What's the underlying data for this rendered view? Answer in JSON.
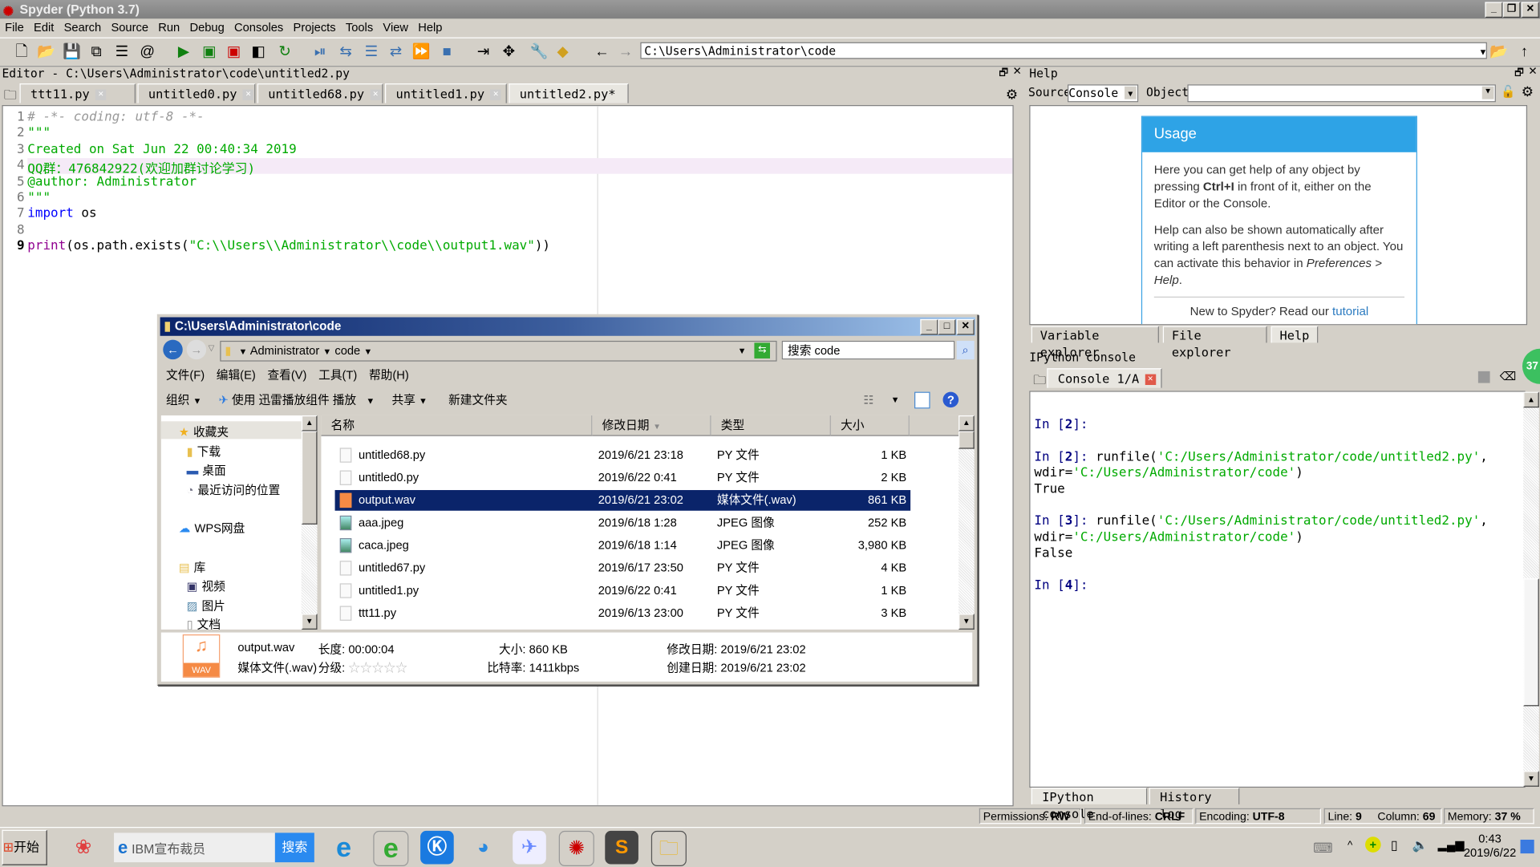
{
  "window": {
    "title": "Spyder (Python 3.7)"
  },
  "menu": [
    "File",
    "Edit",
    "Search",
    "Source",
    "Run",
    "Debug",
    "Consoles",
    "Projects",
    "Tools",
    "View",
    "Help"
  ],
  "toolbar": {
    "path": "C:\\Users\\Administrator\\code"
  },
  "editor": {
    "header": "Editor - C:\\Users\\Administrator\\code\\untitled2.py",
    "tabs": [
      {
        "label": "ttt11.py",
        "active": false
      },
      {
        "label": "untitled0.py",
        "active": false
      },
      {
        "label": "untitled68.py",
        "active": false
      },
      {
        "label": "untitled1.py",
        "active": false
      },
      {
        "label": "untitled2.py*",
        "active": true
      }
    ],
    "current_line": 4,
    "lines": [
      {
        "n": "1",
        "segs": [
          {
            "t": "# -*- coding: utf-8 -*-",
            "k": "comment"
          }
        ]
      },
      {
        "n": "2",
        "segs": [
          {
            "t": "\"\"\"",
            "k": "string"
          }
        ]
      },
      {
        "n": "3",
        "segs": [
          {
            "t": "Created on Sat Jun 22 00:40:34 2019",
            "k": "string"
          }
        ]
      },
      {
        "n": "4",
        "segs": [
          {
            "t": "QQ群：476842922(欢迎加群讨论学习)",
            "k": "string"
          }
        ]
      },
      {
        "n": "5",
        "segs": [
          {
            "t": "@author: Administrator",
            "k": "string"
          }
        ]
      },
      {
        "n": "6",
        "segs": [
          {
            "t": "\"\"\"",
            "k": "string"
          }
        ]
      },
      {
        "n": "7",
        "segs": [
          {
            "t": "import",
            "k": "keyword"
          },
          {
            "t": " os",
            "k": "plain"
          }
        ]
      },
      {
        "n": "8",
        "segs": []
      },
      {
        "n": "9",
        "segs": [
          {
            "t": "print",
            "k": "builtin"
          },
          {
            "t": "(os.path.exists(",
            "k": "plain"
          },
          {
            "t": "\"C:\\\\Users\\\\Administrator\\\\code\\\\output1.wav\"",
            "k": "string"
          },
          {
            "t": "))",
            "k": "plain"
          }
        ]
      }
    ]
  },
  "help": {
    "title": "Help",
    "source_label": "Source",
    "source_value": "Console",
    "object_label": "Object",
    "object_value": "",
    "usage_title": "Usage",
    "p1_a": "Here you can get help of any object by pressing ",
    "p1_b": "Ctrl+I",
    "p1_c": " in front of it, either on the Editor or the Console.",
    "p2_a": "Help can also be shown automatically after writing a left parenthesis next to an object. You can activate this behavior in ",
    "p2_b": "Preferences > Help",
    "p2_c": ".",
    "p3_a": "New to Spyder? Read our ",
    "p3_b": "tutorial"
  },
  "pane_tabs": [
    "Variable explorer",
    "File explorer",
    "Help"
  ],
  "console": {
    "title": "IPython console",
    "tab": "Console 1/A",
    "badge": "37",
    "lines": [
      {
        "segs": [
          {
            "t": "In [",
            "k": "pr"
          },
          {
            "t": "2",
            "k": "prn"
          },
          {
            "t": "]:",
            "k": "pr"
          }
        ]
      },
      {
        "segs": []
      },
      {
        "segs": [
          {
            "t": "In [",
            "k": "pr"
          },
          {
            "t": "2",
            "k": "prn"
          },
          {
            "t": "]: ",
            "k": "pr"
          },
          {
            "t": "runfile(",
            "k": "plain"
          },
          {
            "t": "'C:/Users/Administrator/code/untitled2.py'",
            "k": "string"
          },
          {
            "t": ",",
            "k": "plain"
          }
        ]
      },
      {
        "segs": [
          {
            "t": "wdir=",
            "k": "plain"
          },
          {
            "t": "'C:/Users/Administrator/code'",
            "k": "string"
          },
          {
            "t": ")",
            "k": "plain"
          }
        ]
      },
      {
        "segs": [
          {
            "t": "True",
            "k": "plain"
          }
        ]
      },
      {
        "segs": []
      },
      {
        "segs": [
          {
            "t": "In [",
            "k": "pr"
          },
          {
            "t": "3",
            "k": "prn"
          },
          {
            "t": "]: ",
            "k": "pr"
          },
          {
            "t": "runfile(",
            "k": "plain"
          },
          {
            "t": "'C:/Users/Administrator/code/untitled2.py'",
            "k": "string"
          },
          {
            "t": ",",
            "k": "plain"
          }
        ]
      },
      {
        "segs": [
          {
            "t": "wdir=",
            "k": "plain"
          },
          {
            "t": "'C:/Users/Administrator/code'",
            "k": "string"
          },
          {
            "t": ")",
            "k": "plain"
          }
        ]
      },
      {
        "segs": [
          {
            "t": "False",
            "k": "plain"
          }
        ]
      },
      {
        "segs": []
      },
      {
        "segs": [
          {
            "t": "In [",
            "k": "pr"
          },
          {
            "t": "4",
            "k": "prn"
          },
          {
            "t": "]:",
            "k": "pr"
          }
        ]
      }
    ],
    "bottom_tabs": [
      "IPython console",
      "History log"
    ]
  },
  "status": {
    "permissions_label": "Permissions:",
    "permissions": "RW",
    "eol_label": "End-of-lines:",
    "eol": "CRLF",
    "encoding_label": "Encoding:",
    "encoding": "UTF-8",
    "line_label": "Line:",
    "line": "9",
    "column_label": "Column:",
    "column": "69",
    "memory_label": "Memory:",
    "memory": "37 %"
  },
  "explorer": {
    "title": "C:\\Users\\Administrator\\code",
    "breadcrumb": [
      "Administrator",
      "code"
    ],
    "search_placeholder": "搜索 code",
    "menu": [
      "文件(F)",
      "编辑(E)",
      "查看(V)",
      "工具(T)",
      "帮助(H)"
    ],
    "commands": {
      "organize": "组织",
      "play": "使用 迅雷播放组件 播放",
      "share": "共享",
      "new_folder": "新建文件夹"
    },
    "nav": [
      {
        "label": "收藏夹",
        "icon": "star",
        "indent": 0
      },
      {
        "label": "下载",
        "icon": "download-folder",
        "indent": 1
      },
      {
        "label": "桌面",
        "icon": "desktop",
        "indent": 1
      },
      {
        "label": "最近访问的位置",
        "icon": "recent",
        "indent": 1
      },
      {
        "label": "WPS网盘",
        "icon": "cloud",
        "indent": 0
      },
      {
        "label": "库",
        "icon": "library",
        "indent": 0
      },
      {
        "label": "视频",
        "icon": "video",
        "indent": 1
      },
      {
        "label": "图片",
        "icon": "pictures",
        "indent": 1
      },
      {
        "label": "文档",
        "icon": "documents",
        "indent": 1
      }
    ],
    "columns": [
      "名称",
      "修改日期",
      "类型",
      "大小"
    ],
    "files": [
      {
        "name": "untitled68.py",
        "date": "2019/6/21 23:18",
        "type": "PY 文件",
        "size": "1 KB",
        "icon": "file"
      },
      {
        "name": "untitled0.py",
        "date": "2019/6/22 0:41",
        "type": "PY 文件",
        "size": "2 KB",
        "icon": "file"
      },
      {
        "name": "output.wav",
        "date": "2019/6/21 23:02",
        "type": "媒体文件(.wav)",
        "size": "861 KB",
        "icon": "wav",
        "selected": true
      },
      {
        "name": "aaa.jpeg",
        "date": "2019/6/18 1:28",
        "type": "JPEG 图像",
        "size": "252 KB",
        "icon": "img"
      },
      {
        "name": "caca.jpeg",
        "date": "2019/6/18 1:14",
        "type": "JPEG 图像",
        "size": "3,980 KB",
        "icon": "img"
      },
      {
        "name": "untitled67.py",
        "date": "2019/6/17 23:50",
        "type": "PY 文件",
        "size": "4 KB",
        "icon": "file"
      },
      {
        "name": "untitled1.py",
        "date": "2019/6/22 0:41",
        "type": "PY 文件",
        "size": "1 KB",
        "icon": "file"
      },
      {
        "name": "ttt11.py",
        "date": "2019/6/13 23:00",
        "type": "PY 文件",
        "size": "3 KB",
        "icon": "file"
      }
    ],
    "details": {
      "name": "output.wav",
      "kind": "媒体文件(.wav)",
      "wav_label": "WAV",
      "length_label": "长度:",
      "length": "00:00:04",
      "rating_label": "分级:",
      "rating": 0,
      "rating_stars": "☆☆☆☆☆",
      "size_label": "大小:",
      "size": "860 KB",
      "bitrate_label": "比特率:",
      "bitrate": "1411kbps",
      "modified_label": "修改日期:",
      "modified": "2019/6/21 23:02",
      "created_label": "创建日期:",
      "created": "2019/6/21 23:02"
    }
  },
  "taskbar": {
    "start": "开始",
    "search_text": "IBM宣布裁员",
    "search_button": "搜索",
    "time": "0:43",
    "date": "2019/6/22"
  }
}
